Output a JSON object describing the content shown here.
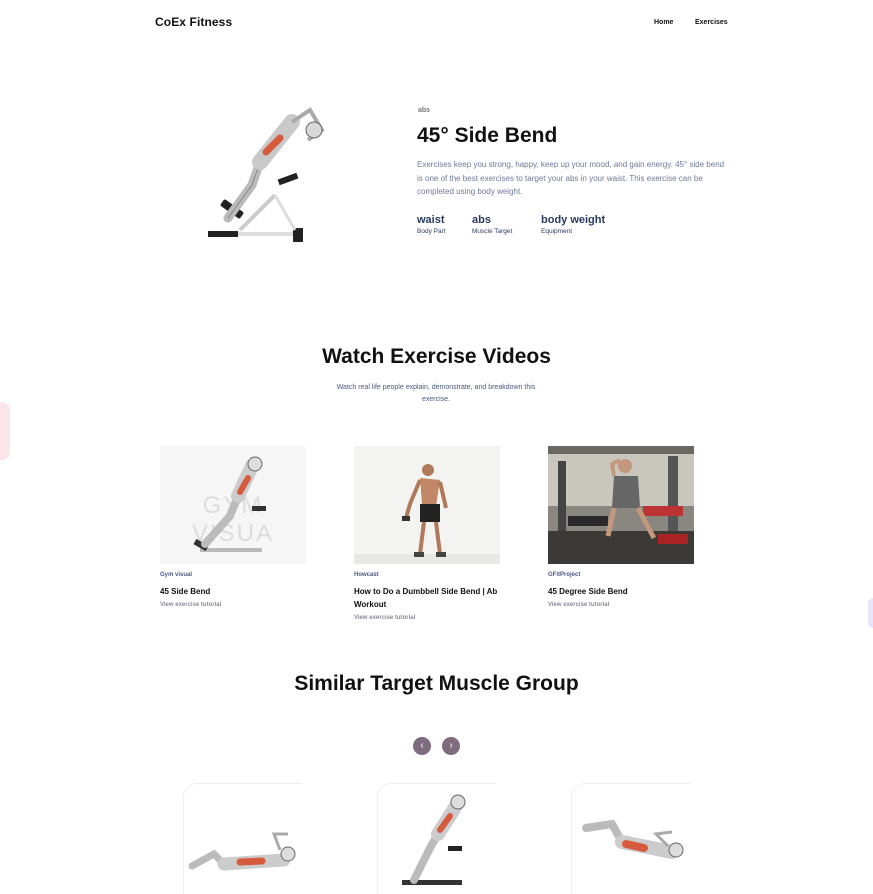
{
  "header": {
    "brand": "CoEx Fitness",
    "nav": {
      "home": "Home",
      "exercises": "Exercises"
    }
  },
  "exercise": {
    "tag": "abs",
    "title": "45° Side Bend",
    "description": "Exercises keep you strong, happy, keep up your mood, and gain energy. 45° side bend is one of the best exercises to target your abs in your waist. This exercise can be completed using body weight.",
    "stats": [
      {
        "value": "waist",
        "label": "Body Part"
      },
      {
        "value": "abs",
        "label": "Muscle Target"
      },
      {
        "value": "body weight",
        "label": "Equipment"
      }
    ]
  },
  "videos": {
    "title": "Watch Exercise Videos",
    "subtitle": "Watch real life people explain, demonstrate, and breakdown this exercise.",
    "items": [
      {
        "channel": "Gym visual",
        "title": "45 Side Bend",
        "link": "View exercise tutorial",
        "watermark": "GYM VISUA"
      },
      {
        "channel": "Howcast",
        "title": "How to Do a Dumbbell Side Bend | Ab Workout",
        "link": "View exercise tutorial"
      },
      {
        "channel": "GFitProject",
        "title": "45 Degree Side Bend",
        "link": "View exercise tutorial"
      }
    ]
  },
  "similar": {
    "title": "Similar Target Muscle Group",
    "prev_icon": "chevron-left-icon",
    "next_icon": "chevron-right-icon"
  }
}
